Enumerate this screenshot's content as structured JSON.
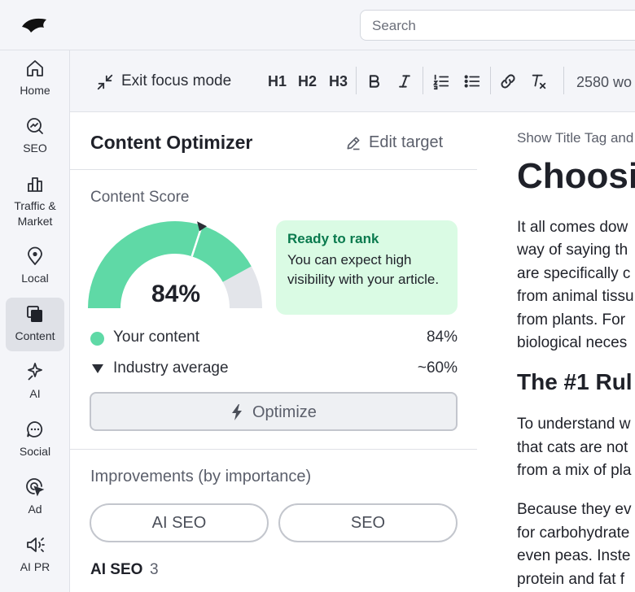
{
  "app": {
    "search_placeholder": "Search",
    "brand_color": "#1f2129",
    "accent_color": "#5fd9a6"
  },
  "sidebar": {
    "items": [
      {
        "label": "Home",
        "icon": "home-icon"
      },
      {
        "label": "SEO",
        "icon": "seo-icon"
      },
      {
        "label": "Traffic & Market",
        "icon": "bar-chart-icon"
      },
      {
        "label": "Local",
        "icon": "map-pin-icon"
      },
      {
        "label": "Content",
        "icon": "content-icon",
        "active": true
      },
      {
        "label": "AI",
        "icon": "ai-icon"
      },
      {
        "label": "Social",
        "icon": "chat-bubble-icon"
      },
      {
        "label": "Ad",
        "icon": "ad-target-icon"
      },
      {
        "label": "AI PR",
        "icon": "megaphone-icon"
      }
    ]
  },
  "toolbar": {
    "exit_focus_label": "Exit focus mode",
    "h1_label": "H1",
    "h2_label": "H2",
    "h3_label": "H3",
    "word_count": "2580 wo"
  },
  "optimizer": {
    "title": "Content Optimizer",
    "edit_target_label": "Edit target",
    "score_heading": "Content Score",
    "score_value": "84%",
    "score_fraction": 0.84,
    "industry_fraction": 0.6,
    "rank_title": "Ready to rank",
    "rank_body": "You can expect high visibility with your article.",
    "legend": [
      {
        "label": "Your content",
        "value": "84%"
      },
      {
        "label": "Industry average",
        "value": "~60%"
      }
    ],
    "optimize_label": "Optimize",
    "improvements_title": "Improvements (by importance)",
    "tabs": [
      "AI SEO",
      "SEO"
    ],
    "section_label": "AI SEO",
    "section_count": "3"
  },
  "document": {
    "meta": "Show Title Tag and",
    "title": "Choosi",
    "paragraph1": [
      "It all comes dow",
      "way of saying th",
      "are specifically c",
      "from animal tissu",
      "from plants. For",
      "biological neces"
    ],
    "heading2": "The #1 Rul",
    "paragraph2": [
      "To understand w",
      "that cats are not",
      "from a mix of pla"
    ],
    "paragraph3": [
      "Because they ev",
      "for carbohydrate",
      "even peas. Inste",
      "protein and fat f"
    ]
  }
}
